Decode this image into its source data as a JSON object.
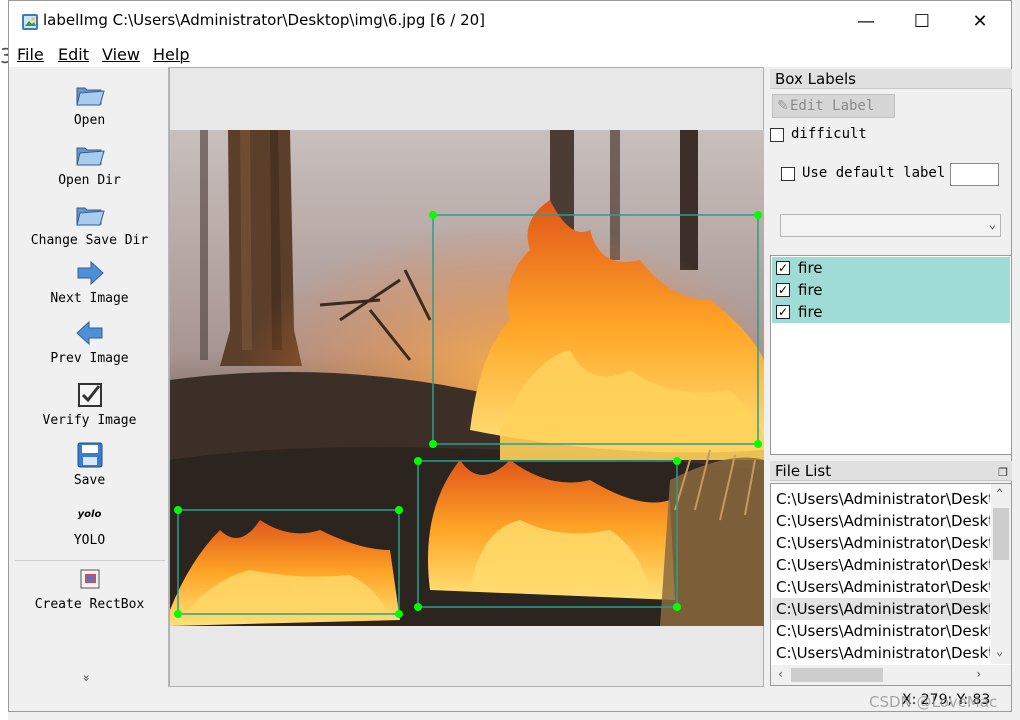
{
  "window": {
    "title": "labelImg C:\\Users\\Administrator\\Desktop\\img\\6.jpg [6 / 20]",
    "minimize_glyph": "—",
    "maximize_glyph": "☐",
    "close_glyph": "✕"
  },
  "menu": [
    "File",
    "Edit",
    "View",
    "Help"
  ],
  "toolbar": {
    "open": "Open",
    "open_dir": "Open Dir",
    "change_save_dir": "Change Save Dir",
    "next_image": "Next Image",
    "prev_image": "Prev Image",
    "verify_image": "Verify Image",
    "save": "Save",
    "format_icon_text": "yolo",
    "format": "YOLO",
    "create_rectbox": "Create RectBox",
    "more": "»"
  },
  "box_labels": {
    "title": "Box Labels",
    "edit_label": "Edit Label",
    "difficult": "difficult",
    "use_default_label": "Use default label",
    "default_label_value": "",
    "combo_value": "",
    "labels": [
      {
        "text": "fire",
        "checked": true
      },
      {
        "text": "fire",
        "checked": true
      },
      {
        "text": "fire",
        "checked": true
      }
    ],
    "check_glyph": "✓"
  },
  "file_list": {
    "title": "File List",
    "files": [
      "C:\\Users\\Administrator\\Deskt",
      "C:\\Users\\Administrator\\Deskt",
      "C:\\Users\\Administrator\\Deskt",
      "C:\\Users\\Administrator\\Deskt",
      "C:\\Users\\Administrator\\Deskt",
      "C:\\Users\\Administrator\\Deskt",
      "C:\\Users\\Administrator\\Deskt",
      "C:\\Users\\Administrator\\Deskt"
    ],
    "selected_index": 5
  },
  "status": {
    "coords": "X: 279; Y: 83"
  },
  "overlay": {
    "watermark": "CSDN @LoveMac"
  },
  "colors": {
    "label_highlight": "#9fdcd6",
    "bbox_line": "#2a9d8f",
    "bbox_vertex": "#00ff00",
    "file_selected": "#e3e3e3"
  }
}
